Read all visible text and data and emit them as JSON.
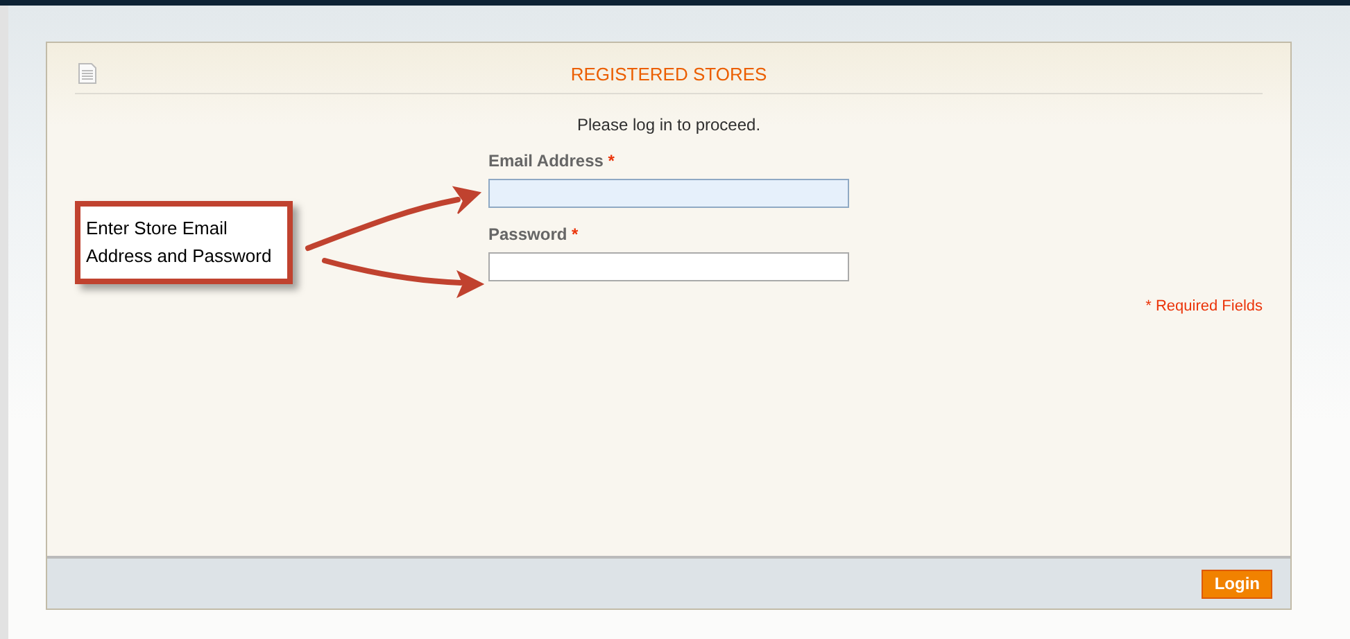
{
  "panel": {
    "title": "REGISTERED STORES",
    "intro": "Please log in to proceed.",
    "fields": [
      {
        "label": "Email Address",
        "required_mark": "*",
        "focused": true
      },
      {
        "label": "Password",
        "required_mark": "*",
        "focused": false
      }
    ],
    "required_note": "* Required Fields"
  },
  "footer": {
    "button": "Login"
  },
  "annotation": {
    "text": "Enter Store Email Address and Password"
  }
}
